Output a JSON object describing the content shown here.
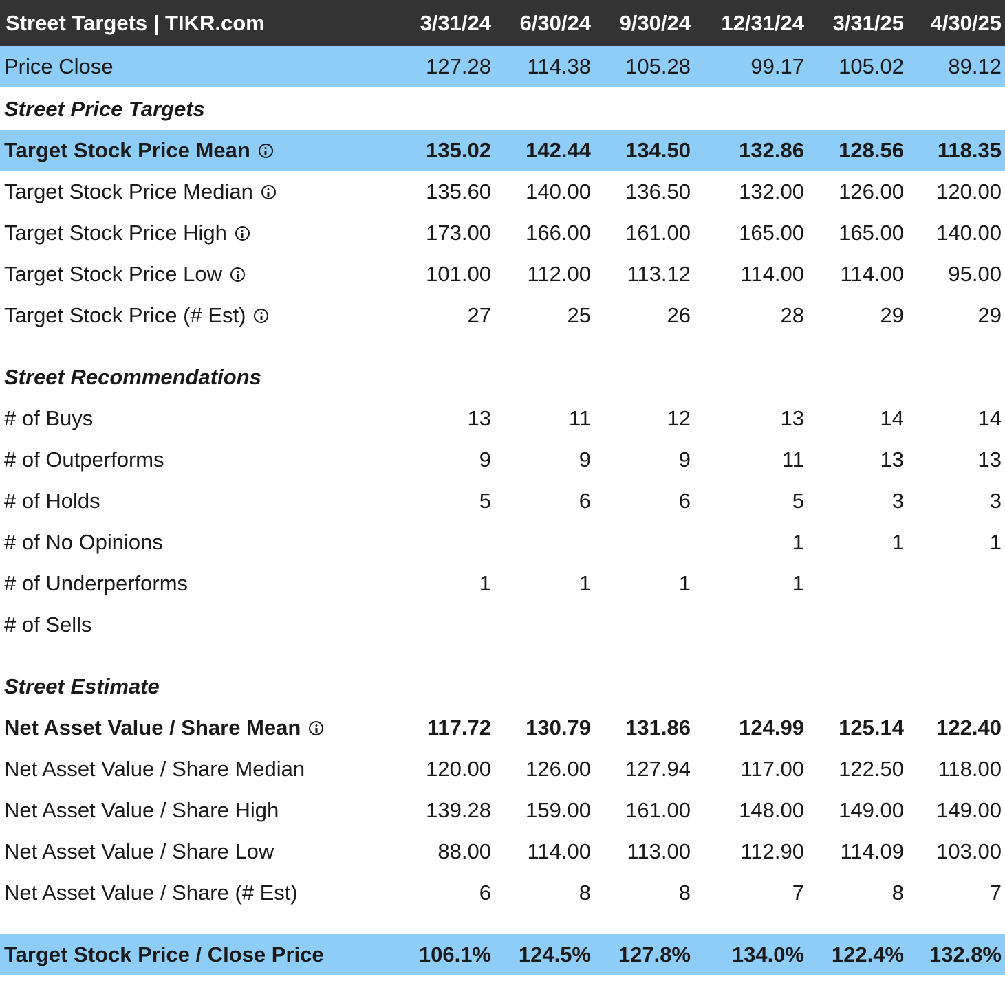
{
  "header": {
    "title": "Street Targets | TIKR.com",
    "dates": [
      "3/31/24",
      "6/30/24",
      "9/30/24",
      "12/31/24",
      "3/31/25",
      "4/30/25"
    ]
  },
  "price_close": {
    "label": "Price Close",
    "values": [
      "127.28",
      "114.38",
      "105.28",
      "99.17",
      "105.02",
      "89.12"
    ]
  },
  "sections": {
    "price_targets": {
      "title": "Street Price Targets",
      "rows": [
        {
          "label": "Target Stock Price Mean",
          "values": [
            "135.02",
            "142.44",
            "134.50",
            "132.86",
            "128.56",
            "118.35"
          ]
        },
        {
          "label": "Target Stock Price Median",
          "values": [
            "135.60",
            "140.00",
            "136.50",
            "132.00",
            "126.00",
            "120.00"
          ]
        },
        {
          "label": "Target Stock Price High",
          "values": [
            "173.00",
            "166.00",
            "161.00",
            "165.00",
            "165.00",
            "140.00"
          ]
        },
        {
          "label": "Target Stock Price Low",
          "values": [
            "101.00",
            "112.00",
            "113.12",
            "114.00",
            "114.00",
            "95.00"
          ]
        },
        {
          "label": "Target Stock Price (# Est)",
          "values": [
            "27",
            "25",
            "26",
            "28",
            "29",
            "29"
          ]
        }
      ]
    },
    "recommendations": {
      "title": "Street Recommendations",
      "rows": [
        {
          "label": "# of Buys",
          "values": [
            "13",
            "11",
            "12",
            "13",
            "14",
            "14"
          ]
        },
        {
          "label": "# of Outperforms",
          "values": [
            "9",
            "9",
            "9",
            "11",
            "13",
            "13"
          ]
        },
        {
          "label": "# of Holds",
          "values": [
            "5",
            "6",
            "6",
            "5",
            "3",
            "3"
          ]
        },
        {
          "label": "# of No Opinions",
          "values": [
            "",
            "",
            "",
            "1",
            "1",
            "1"
          ]
        },
        {
          "label": "# of Underperforms",
          "values": [
            "1",
            "1",
            "1",
            "1",
            "",
            ""
          ]
        },
        {
          "label": "# of Sells",
          "values": [
            "",
            "",
            "",
            "",
            "",
            ""
          ]
        }
      ]
    },
    "estimate": {
      "title": "Street Estimate",
      "rows": [
        {
          "label": "Net Asset Value / Share Mean",
          "values": [
            "117.72",
            "130.79",
            "131.86",
            "124.99",
            "125.14",
            "122.40"
          ]
        },
        {
          "label": "Net Asset Value / Share Median",
          "values": [
            "120.00",
            "126.00",
            "127.94",
            "117.00",
            "122.50",
            "118.00"
          ]
        },
        {
          "label": "Net Asset Value / Share High",
          "values": [
            "139.28",
            "159.00",
            "161.00",
            "148.00",
            "149.00",
            "149.00"
          ]
        },
        {
          "label": "Net Asset Value / Share Low",
          "values": [
            "88.00",
            "114.00",
            "113.00",
            "112.90",
            "114.09",
            "103.00"
          ]
        },
        {
          "label": "Net Asset Value / Share (# Est)",
          "values": [
            "6",
            "8",
            "8",
            "7",
            "8",
            "7"
          ]
        }
      ]
    }
  },
  "target_close": {
    "label": "Target Stock Price / Close Price",
    "values": [
      "106.1%",
      "124.5%",
      "127.8%",
      "134.0%",
      "122.4%",
      "132.8%"
    ]
  },
  "colors": {
    "header_bg": "#333333",
    "highlight": "#8ecdf8"
  },
  "icons": {
    "info": "info-circle-icon"
  }
}
